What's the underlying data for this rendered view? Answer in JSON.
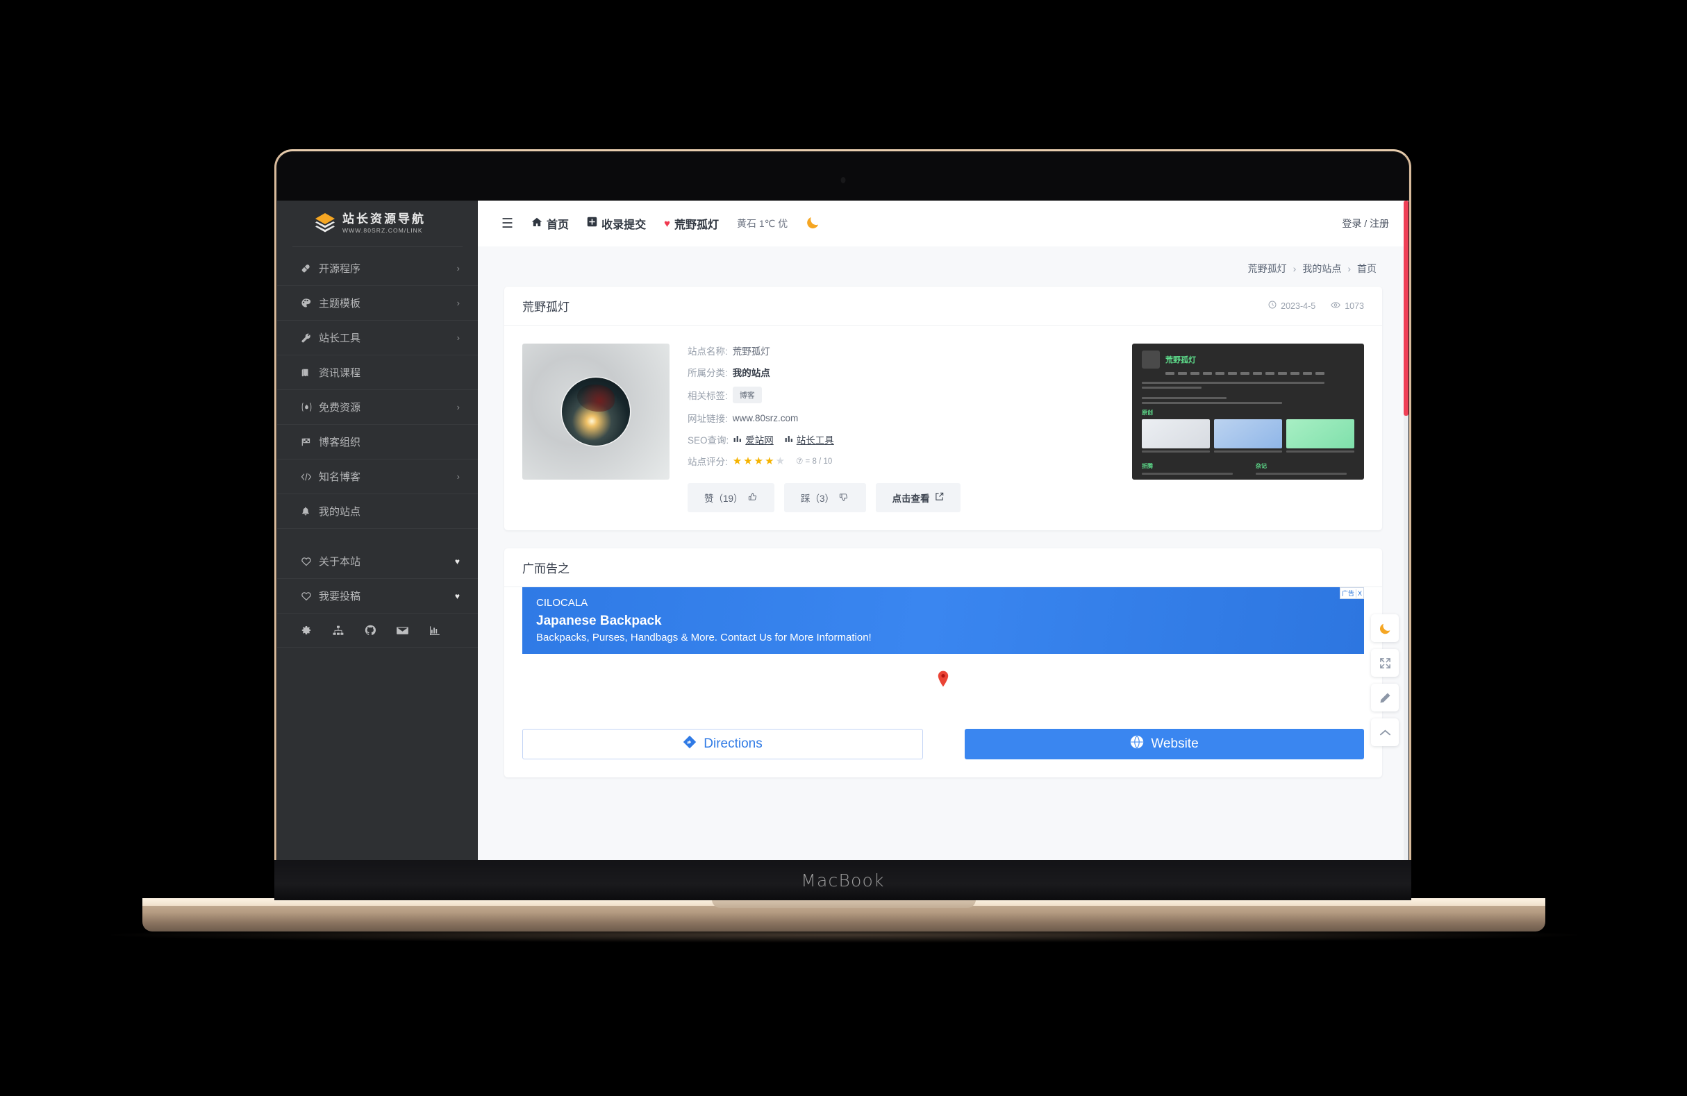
{
  "device": {
    "label": "MacBook"
  },
  "sidebar": {
    "logo": {
      "title": "站长资源导航",
      "subtitle": "WWW.80SRZ.COM/LINK",
      "icon": "layers-icon"
    },
    "items": [
      {
        "label": "开源程序",
        "icon": "plug-icon",
        "arrow": "›"
      },
      {
        "label": "主题模板",
        "icon": "palette-icon",
        "arrow": "›"
      },
      {
        "label": "站长工具",
        "icon": "wrench-icon",
        "arrow": "›"
      },
      {
        "label": "资讯课程",
        "icon": "book-icon",
        "arrow": ""
      },
      {
        "label": "免费资源",
        "icon": "fire-icon",
        "arrow": "›"
      },
      {
        "label": "博客组织",
        "icon": "flag-icon",
        "arrow": ""
      },
      {
        "label": "知名博客",
        "icon": "code-icon",
        "arrow": "›"
      },
      {
        "label": "我的站点",
        "icon": "bell-icon",
        "arrow": ""
      }
    ],
    "secondary": [
      {
        "label": "关于本站",
        "icon": "heart-outline-icon",
        "marker": "♥"
      },
      {
        "label": "我要投稿",
        "icon": "heart-outline-icon",
        "marker": "♥"
      }
    ],
    "social": [
      "gear-icon",
      "sitemap-icon",
      "github-icon",
      "mail-icon",
      "chart-icon"
    ]
  },
  "topbar": {
    "menu_icon": "hamburger-icon",
    "items": [
      {
        "label": "首页",
        "icon": "home-icon"
      },
      {
        "label": "收录提交",
        "icon": "plus-square-icon"
      },
      {
        "label": "荒野孤灯",
        "icon": "heart-filled-icon"
      }
    ],
    "weather": "黄石 1℃ 优",
    "theme_toggle": "moon-icon",
    "account": "登录 / 注册"
  },
  "breadcrumb": {
    "items": [
      "荒野孤灯",
      "我的站点",
      "首页"
    ],
    "separator": "›"
  },
  "site_card": {
    "title": "荒野孤灯",
    "date": "2023-4-5",
    "views": "1073",
    "details": [
      {
        "key": "站点名称:",
        "value": "荒野孤灯",
        "type": "text"
      },
      {
        "key": "所属分类:",
        "value": "我的站点",
        "type": "strong"
      },
      {
        "key": "相关标签:",
        "value": "博客",
        "type": "tag"
      },
      {
        "key": "网址链接:",
        "value": "www.80srz.com",
        "type": "text"
      },
      {
        "key": "SEO查询:",
        "value": "",
        "type": "seo"
      },
      {
        "key": "站点评分:",
        "value": "",
        "type": "rating"
      }
    ],
    "seo_links": [
      {
        "label": "爱站网",
        "icon": "chart-icon"
      },
      {
        "label": "站长工具",
        "icon": "chart-icon"
      }
    ],
    "rating": {
      "stars_filled": 4,
      "stars_total": 5,
      "score_text": "= 8 / 10"
    },
    "buttons": [
      {
        "label": "赞（19）",
        "icon": "thumbs-up-icon"
      },
      {
        "label": "踩（3）",
        "icon": "thumbs-down-icon"
      },
      {
        "label": "点击查看",
        "icon": "external-link-icon"
      }
    ],
    "preview": {
      "site_name": "荒野孤灯",
      "section1": "原创",
      "section2": "折腾",
      "section3": "杂记"
    }
  },
  "ad_card": {
    "section_title": "广而告之",
    "badge": {
      "text": "广告",
      "close": "X"
    },
    "brand": "CILOCALA",
    "headline": "Japanese Backpack",
    "description": "Backpacks, Purses, Handbags & More. Contact Us for More Information!",
    "map_pin": "map-pin-icon",
    "cta": [
      {
        "label": "Directions",
        "icon": "directions-icon",
        "style": "outline"
      },
      {
        "label": "Website",
        "icon": "globe-icon",
        "style": "filled"
      }
    ]
  },
  "float_buttons": [
    {
      "icon": "moon-icon",
      "name": "night-mode"
    },
    {
      "icon": "expand-icon",
      "name": "fullscreen"
    },
    {
      "icon": "pencil-icon",
      "name": "edit"
    },
    {
      "icon": "chevron-up-icon",
      "name": "back-to-top"
    }
  ],
  "colors": {
    "sidebar_bg": "#2e3033",
    "accent_blue": "#3a86f0",
    "scrollbar": "#ef4056",
    "star": "#f5b301",
    "heart": "#f0384f",
    "preview_accent": "#5ddb8a"
  }
}
